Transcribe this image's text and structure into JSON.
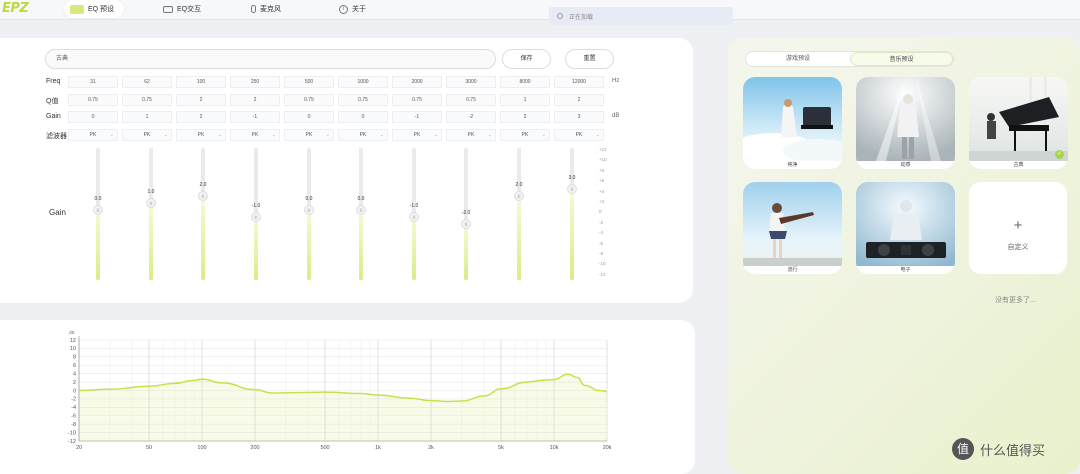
{
  "app": {
    "logo": "EPZ"
  },
  "nav": {
    "tabs": [
      {
        "label": "EQ 预设",
        "icon": "eq-icon"
      },
      {
        "label": "EQ交互",
        "icon": "controller-icon"
      },
      {
        "label": "麦克风",
        "icon": "mic-icon"
      },
      {
        "label": "关于",
        "icon": "info-icon"
      }
    ],
    "active_tab": "EQ 预设"
  },
  "search": {
    "placeholder": "正在加载"
  },
  "eq": {
    "preset_name": "古典",
    "save_label": "保存",
    "reset_label": "重置",
    "rows": {
      "freq": {
        "label": "Freq",
        "unit": "Hz",
        "values": [
          "31",
          "62",
          "100",
          "250",
          "500",
          "1000",
          "2000",
          "3000",
          "8000",
          "12000"
        ]
      },
      "q": {
        "label": "Q值",
        "unit": "",
        "values": [
          "0.75",
          "0.75",
          "2",
          "2",
          "0.75",
          "0.75",
          "0.75",
          "0.75",
          "1",
          "2"
        ]
      },
      "gain": {
        "label": "Gain",
        "unit": "dB",
        "values": [
          "0",
          "1",
          "2",
          "-1",
          "0",
          "0",
          "-1",
          "-2",
          "2",
          "3"
        ]
      },
      "filter": {
        "label": "滤波器",
        "unit": "",
        "values": [
          "PK",
          "PK",
          "PK",
          "PK",
          "PK",
          "PK",
          "PK",
          "PK",
          "PK",
          "PK"
        ]
      }
    },
    "slider_label": "Gain",
    "sliders": [
      {
        "value": 0,
        "label": "0.0"
      },
      {
        "value": 1,
        "label": "1.0"
      },
      {
        "value": 2,
        "label": "2.0"
      },
      {
        "value": -1,
        "label": "-1.0"
      },
      {
        "value": 0,
        "label": "0.0"
      },
      {
        "value": 0,
        "label": "0.0"
      },
      {
        "value": -1,
        "label": "-1.0"
      },
      {
        "value": -2,
        "label": "-2.0"
      },
      {
        "value": 2,
        "label": "2.0"
      },
      {
        "value": 3,
        "label": "3.0"
      }
    ],
    "knob_text": "|||",
    "scale": [
      "+12",
      "+10",
      "+8",
      "+6",
      "+4",
      "+2",
      "0",
      "-2",
      "-4",
      "-6",
      "-8",
      "-10",
      "-12"
    ],
    "range": [
      -12,
      12
    ]
  },
  "chart_data": {
    "type": "area",
    "title": "",
    "xlabel": "",
    "ylabel": "dB",
    "x_scale": "log",
    "xlim": [
      20,
      20000
    ],
    "ylim": [
      -12,
      12
    ],
    "x_ticks": [
      20,
      50,
      100,
      200,
      500,
      1000,
      2000,
      5000,
      10000,
      20000
    ],
    "x_tick_labels": [
      "20",
      "50",
      "100",
      "200",
      "500",
      "1k",
      "2k",
      "5k",
      "10k",
      "20k"
    ],
    "y_ticks": [
      12,
      10,
      8,
      6,
      4,
      2,
      0,
      -2,
      -4,
      -6,
      -8,
      -10,
      -12
    ],
    "grid": true,
    "color": "#c6e24a",
    "x": [
      20,
      30,
      50,
      70,
      90,
      100,
      130,
      200,
      250,
      350,
      500,
      800,
      1000,
      1500,
      2000,
      2500,
      3000,
      4000,
      5000,
      7000,
      9000,
      10000,
      12000,
      13500,
      15000,
      18000,
      20000
    ],
    "y": [
      0.0,
      0.3,
      1.0,
      1.7,
      2.4,
      2.7,
      1.8,
      0.2,
      -0.6,
      -0.5,
      -0.4,
      -0.7,
      -1.1,
      -1.8,
      -2.4,
      -2.6,
      -2.5,
      -1.3,
      0.4,
      2.0,
      2.5,
      2.6,
      3.9,
      3.1,
      1.2,
      0.0,
      -0.2
    ]
  },
  "right": {
    "segments": [
      "游戏预设",
      "音乐预设"
    ],
    "active_segment": "音乐预设",
    "cards": [
      {
        "caption": "纯净",
        "art": "piano-sky"
      },
      {
        "caption": "动感",
        "art": "singer-stage"
      },
      {
        "caption": "古典",
        "art": "grand-piano",
        "selected": true
      },
      {
        "caption": "流行",
        "art": "guitar-girl"
      },
      {
        "caption": "电子",
        "art": "dj-deck"
      }
    ],
    "custom_label": "自定义",
    "no_more": "没有更多了..."
  },
  "watermark": {
    "text": "什么值得买",
    "icon": "value-icon"
  }
}
